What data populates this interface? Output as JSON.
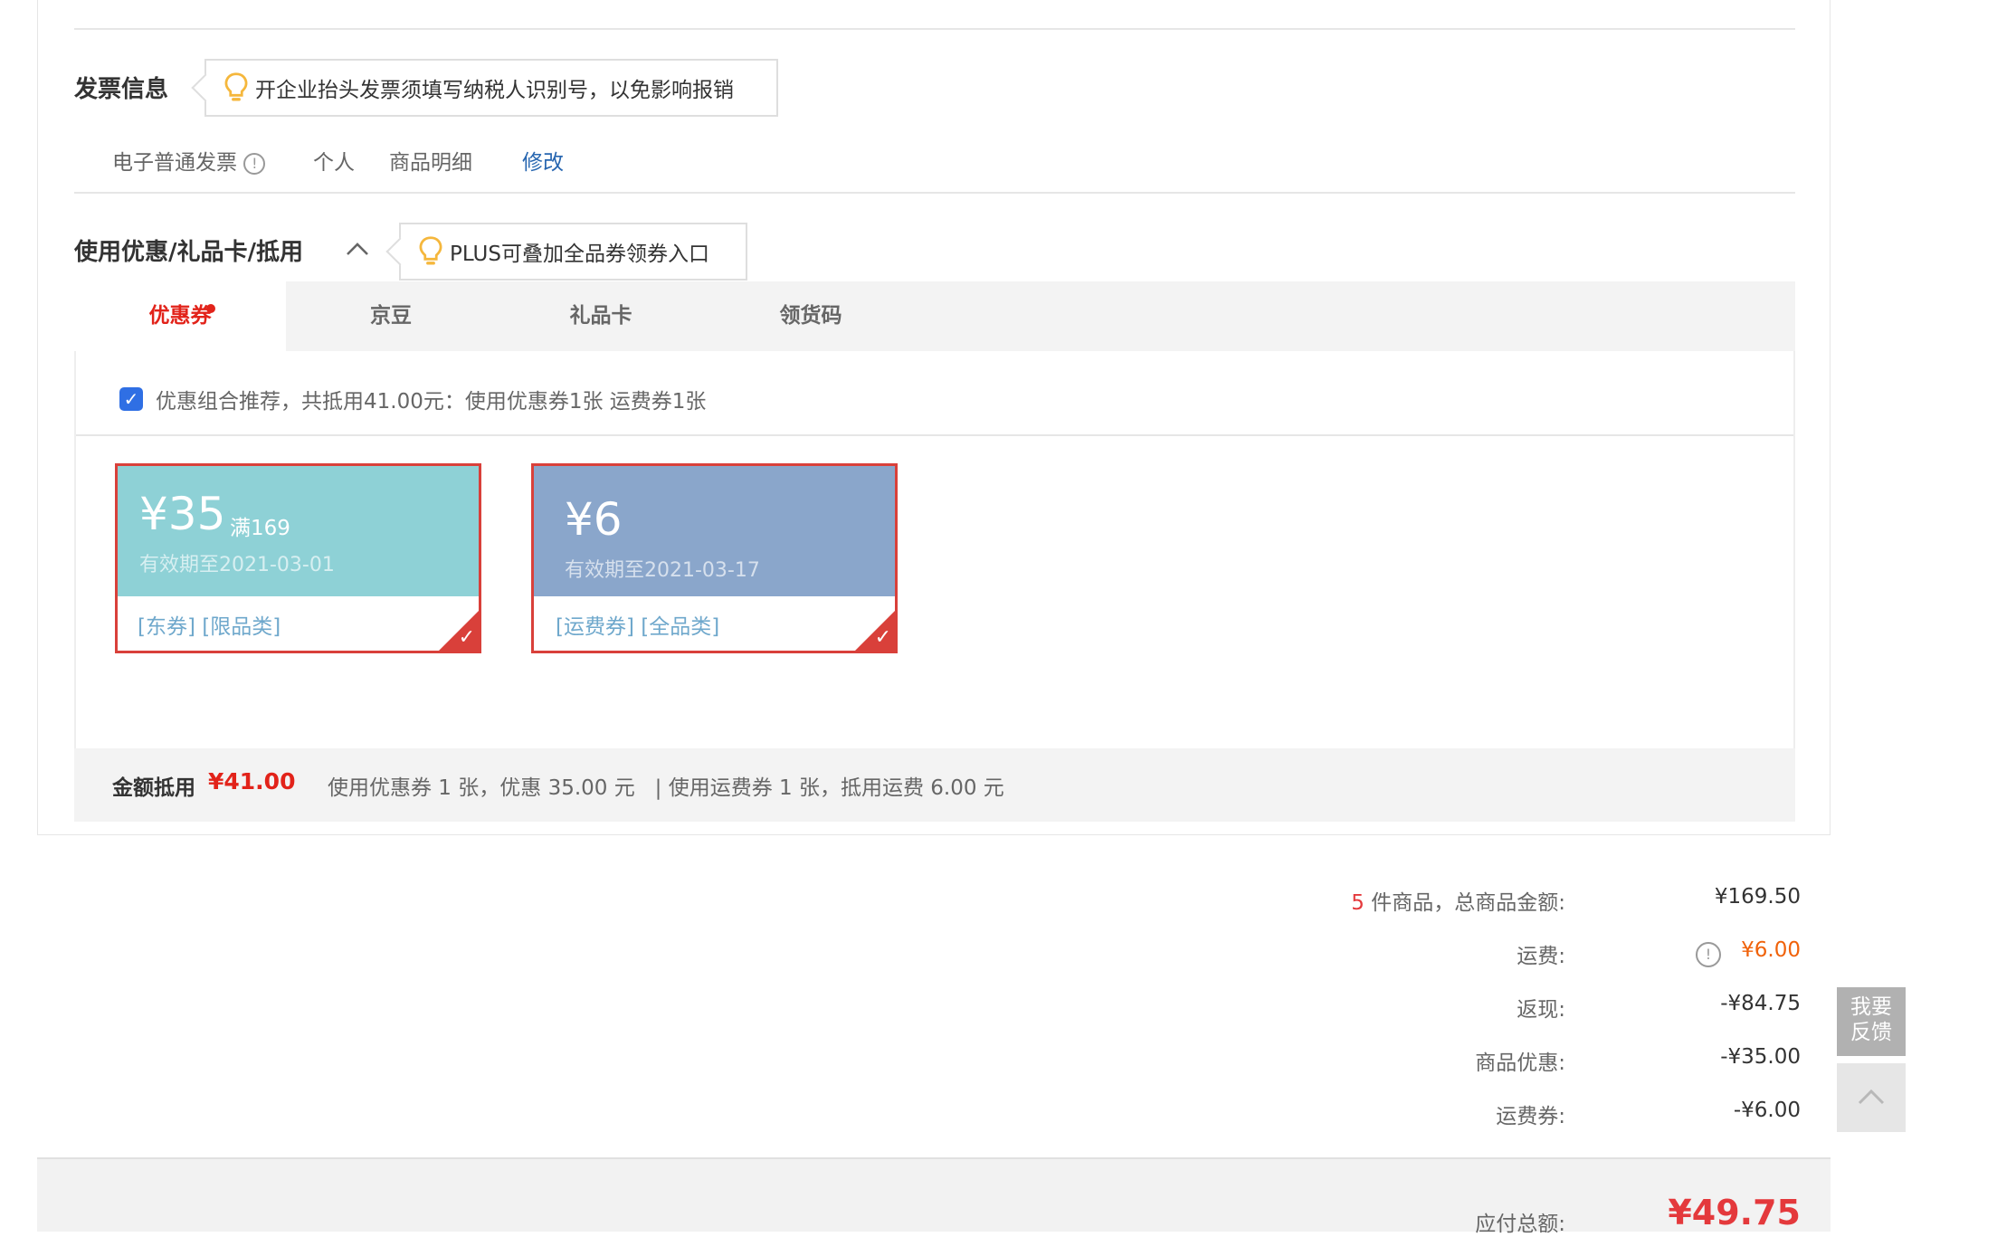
{
  "invoice": {
    "title": "发票信息",
    "tip": "开企业抬头发票须填写纳税人识别号，以免影响报销",
    "type": "电子普通发票",
    "info_glyph": "!",
    "title_type": "个人",
    "content": "商品明细",
    "edit_label": "修改"
  },
  "discount": {
    "title": "使用优惠/礼品卡/抵用",
    "tip": "PLUS可叠加全品券领券入口",
    "collapse_icon": "chevron-up-icon",
    "tabs": [
      {
        "label": "优惠券",
        "active": true,
        "badge": true
      },
      {
        "label": "京豆",
        "active": false
      },
      {
        "label": "礼品卡",
        "active": false
      },
      {
        "label": "领货码",
        "active": false
      }
    ],
    "combo_checked": true,
    "combo_check_glyph": "✓",
    "combo_text": "优惠组合推荐，共抵用41.00元：使用优惠券1张 运费券1张",
    "coupons": [
      {
        "amount": "¥35",
        "condition": "满169",
        "expiry": "有效期至2021-03-01",
        "tags": "[东券]  [限品类]",
        "selected": true,
        "bg": "#8ed1d6",
        "check_glyph": "✓"
      },
      {
        "amount": "¥6",
        "condition": "",
        "expiry": "有效期至2021-03-17",
        "tags": "[运费券]  [全品类]",
        "selected": true,
        "bg": "#8aa6cb",
        "check_glyph": "✓"
      }
    ],
    "summary": {
      "label": "金额抵用",
      "amount": "¥41.00",
      "detail": "使用优惠券 1 张，优惠 35.00 元   | 使用运费券 1 张，抵用运费 6.00 元"
    }
  },
  "order_summary": {
    "count": "5",
    "count_label": " 件商品，总商品金额:",
    "total_goods": "¥169.50",
    "shipping_label": "运费:",
    "shipping_info_glyph": "!",
    "shipping_value": "¥6.00",
    "cashback_label": "返现:",
    "cashback_value": "-¥84.75",
    "goods_discount_label": "商品优惠:",
    "goods_discount_value": "-¥35.00",
    "shipping_coupon_label": "运费券:",
    "shipping_coupon_value": "-¥6.00",
    "payable_label": "应付总额:",
    "payable_value": "¥49.75"
  },
  "side": {
    "feedback_line1": "我要",
    "feedback_line2": "反馈",
    "top_icon": "chevron-up-icon"
  },
  "colors": {
    "accent_red": "#e2231a",
    "orange": "#e4393c",
    "link_blue": "#2766b0"
  }
}
